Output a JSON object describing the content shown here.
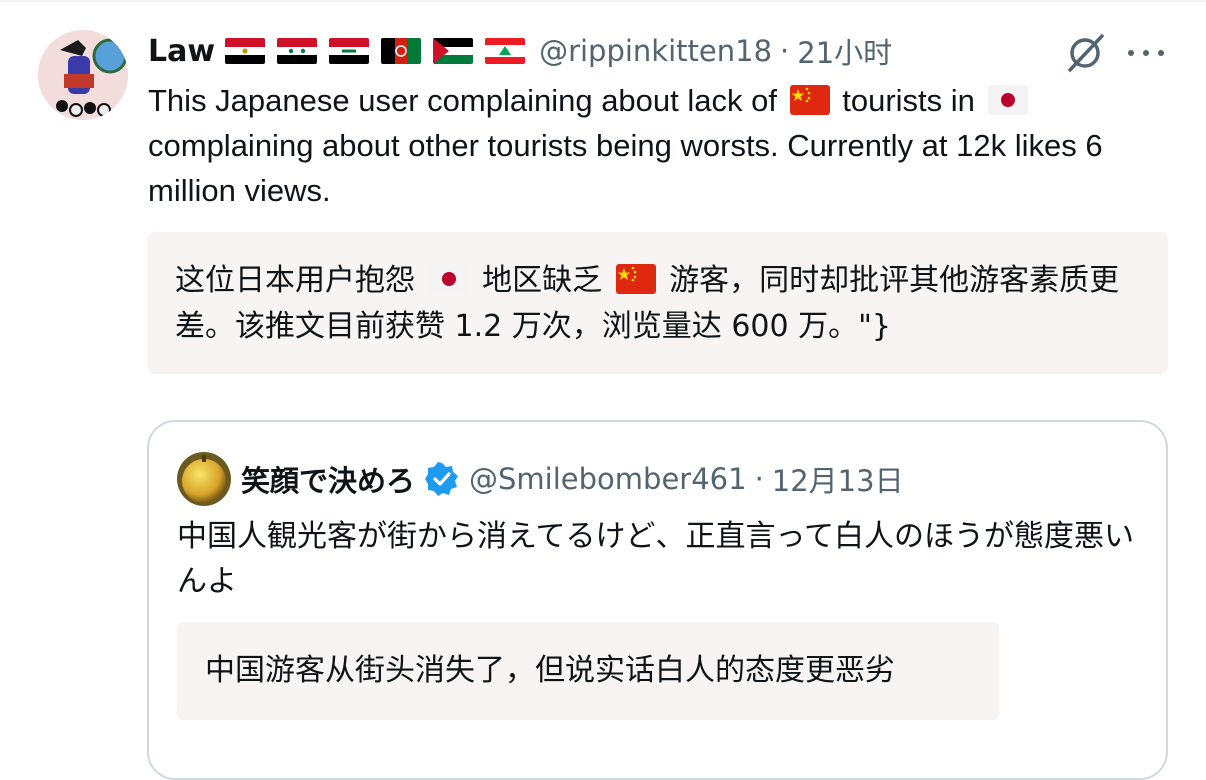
{
  "post": {
    "author": {
      "name": "Law",
      "flags": [
        {
          "icon": "egypt-flag-icon"
        },
        {
          "icon": "syria-flag-icon"
        },
        {
          "icon": "iraq-flag-icon"
        },
        {
          "icon": "afghanistan-flag-icon"
        },
        {
          "icon": "palestine-flag-icon"
        },
        {
          "icon": "lebanon-flag-icon"
        }
      ],
      "handle": "@rippinkitten18",
      "separator": "·",
      "time": "21小时"
    },
    "text": {
      "line_a": "This Japanese user complaining about lack of",
      "emoji_china": "china-flag-emoji",
      "line_b": "tourists in",
      "emoji_japan": "japan-flag-emoji",
      "line_c": "complaining about other tourists being worsts. Currently at 12k likes 6 million views."
    },
    "translation": {
      "part_a": "这位日本用户抱怨",
      "part_b": "地区缺乏",
      "part_c": "游客，同时却批评其他游客素质更差。该推文目前获赞 1.2 万次，浏览量达 600 万。\"}"
    }
  },
  "quoted": {
    "name": "笑顔で決めろ",
    "handle": "@Smilebomber461",
    "separator": "·",
    "date": "12月13日",
    "text": "中国人観光客が街から消えてるけど、正直言って白人のほうが態度悪いんよ",
    "translation": "中国游客从街头消失了，但说实话白人的态度更恶劣"
  },
  "colors": {
    "text": "#0f1419",
    "muted": "#536471",
    "translation_bg": "#f7f4f3",
    "card_border": "#cfd9de",
    "verified": "#1d9bf0"
  }
}
